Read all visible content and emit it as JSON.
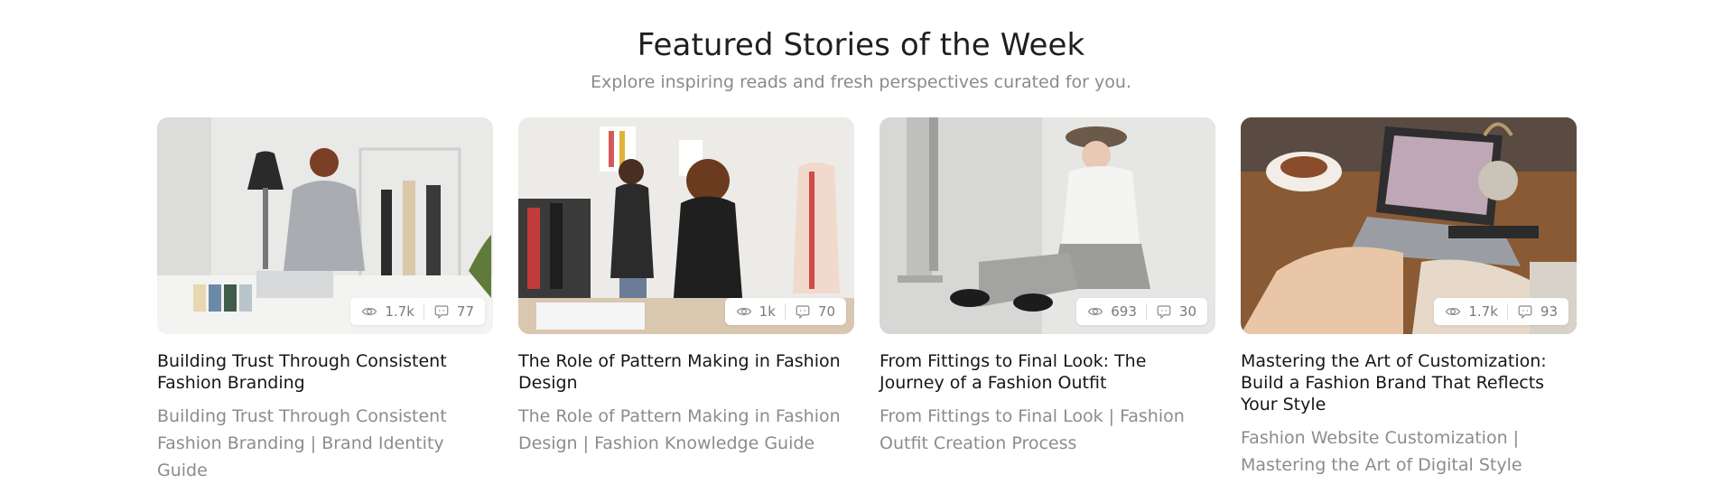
{
  "header": {
    "title": "Featured Stories of the Week",
    "subtitle": "Explore inspiring reads and fresh perspectives curated for you."
  },
  "cards": [
    {
      "image": "designer-at-desk-with-mannequins",
      "views": "1.7k",
      "comments": "77",
      "title": "Building Trust Through Consistent Fashion Branding",
      "description": "Building Trust Through Consistent Fashion Branding | Brand Identity Guide"
    },
    {
      "image": "women-pinning-sketches-on-wall",
      "views": "1k",
      "comments": "70",
      "title": "The Role of Pattern Making in Fashion Design",
      "description": "The Role of Pattern Making in Fashion Design | Fashion Knowledge Guide"
    },
    {
      "image": "seated-model-in-cap-and-trousers",
      "views": "693",
      "comments": "30",
      "title": "From Fittings to Final Look: The Journey of a Fashion Outfit",
      "description": "From Fittings to Final Look | Fashion Outfit Creation Process"
    },
    {
      "image": "hands-on-laptop-at-wooden-table",
      "views": "1.7k",
      "comments": "93",
      "title": "Mastering the Art of Customization: Build a Fashion Brand That Reflects Your Style",
      "description": "Fashion Website Customization | Mastering the Art of Digital Style"
    }
  ],
  "icons": {
    "views": "eye-icon",
    "comments": "comment-icon"
  },
  "colors": {
    "title": "#1f1f1f",
    "subtitle": "#8a8a8a",
    "description": "#8c8c8c",
    "stat_text": "#7a7a7a"
  }
}
